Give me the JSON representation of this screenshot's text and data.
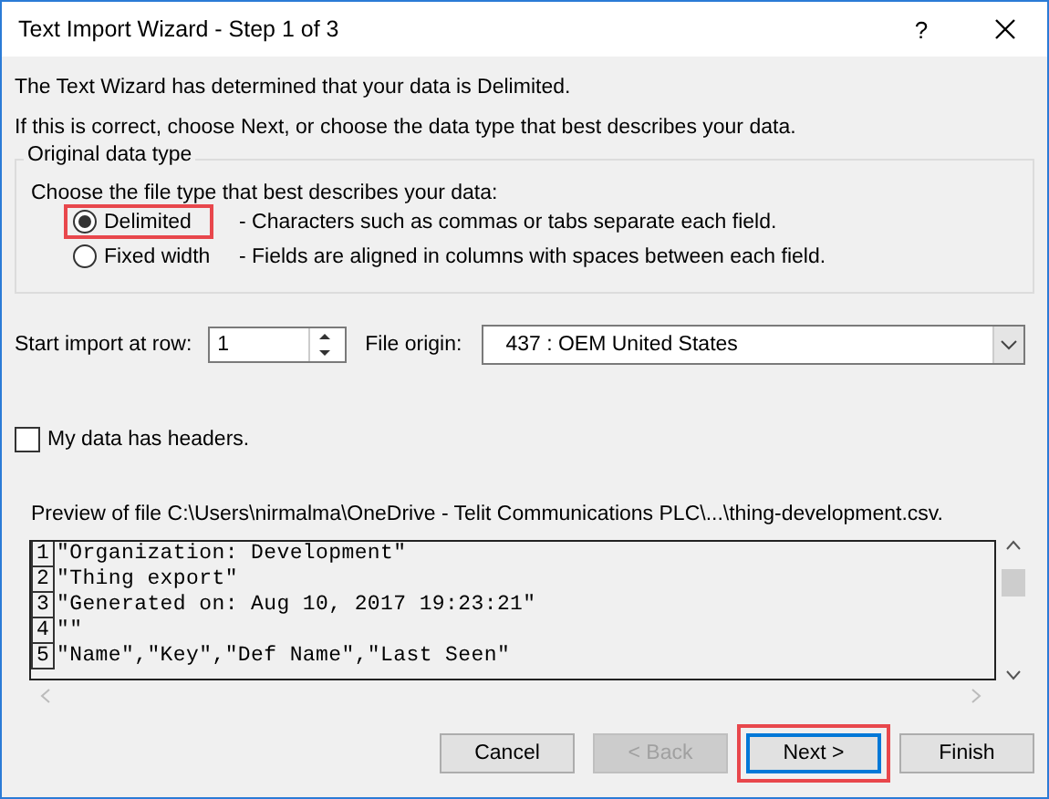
{
  "window": {
    "title": "Text Import Wizard - Step 1 of 3",
    "help": "?"
  },
  "intro": [
    "The Text Wizard has determined that your data is Delimited.",
    "If this is correct, choose Next, or choose the data type that best describes your data."
  ],
  "data_type_group": {
    "title": "Original data type",
    "prompt": "Choose the file type that best describes your data:",
    "options": [
      {
        "label": "Delimited",
        "description": "- Characters such as commas or tabs separate each field.",
        "selected": true,
        "highlighted": true
      },
      {
        "label": "Fixed width",
        "description": "- Fields are aligned in columns with spaces between each field.",
        "selected": false,
        "highlighted": false
      }
    ]
  },
  "start_row": {
    "label": "Start import at row:",
    "value": "1"
  },
  "file_origin": {
    "label": "File origin:",
    "value": "437 : OEM United States"
  },
  "headers_checkbox": {
    "label": "My data has headers.",
    "checked": false
  },
  "preview": {
    "label": "Preview of file C:\\Users\\nirmalma\\OneDrive - Telit Communications PLC\\...\\thing-development.csv.",
    "rows": [
      {
        "number": "1",
        "text": "\"Organization: Development\""
      },
      {
        "number": "2",
        "text": "\"Thing export\""
      },
      {
        "number": "3",
        "text": "\"Generated on: Aug 10, 2017 19:23:21\""
      },
      {
        "number": "4",
        "text": "\"\""
      },
      {
        "number": "5",
        "text": "\"Name\",\"Key\",\"Def Name\",\"Last Seen\""
      }
    ]
  },
  "buttons": [
    {
      "label": "Cancel",
      "disabled": false,
      "highlighted": false,
      "selected": false
    },
    {
      "label": "< Back",
      "disabled": true,
      "highlighted": false,
      "selected": false
    },
    {
      "label": "Next >",
      "disabled": false,
      "highlighted": true,
      "selected": true
    },
    {
      "label": "Finish",
      "disabled": false,
      "highlighted": false,
      "selected": false
    }
  ]
}
